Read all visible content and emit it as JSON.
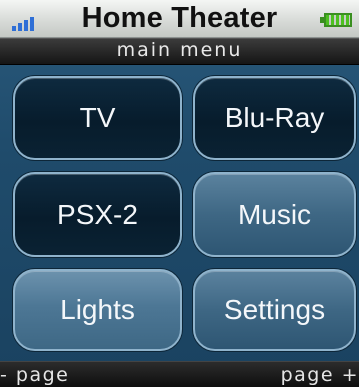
{
  "status_bar": {
    "title": "Home Theater",
    "signal_icon": "signal-strength-icon",
    "battery_icon": "battery-icon",
    "colors": {
      "signal": "#2f6fd6",
      "battery": "#4dc020"
    }
  },
  "menu_header": {
    "label": "main menu"
  },
  "buttons": [
    {
      "label": "TV",
      "style": "dark"
    },
    {
      "label": "Blu-Ray",
      "style": "dark"
    },
    {
      "label": "PSX-2",
      "style": "dark"
    },
    {
      "label": "Music",
      "style": "medium"
    },
    {
      "label": "Lights",
      "style": "light"
    },
    {
      "label": "Settings",
      "style": "medium"
    }
  ],
  "bottom_bar": {
    "left_softkey": "- page",
    "right_softkey": "page +"
  }
}
